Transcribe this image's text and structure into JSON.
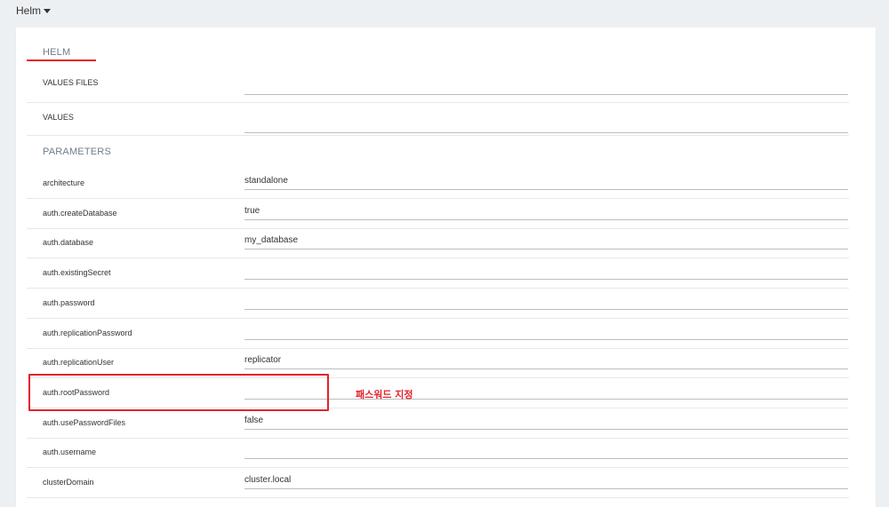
{
  "header": {
    "menu_label": "Helm"
  },
  "helm": {
    "section_title": "HELM",
    "values_files_label": "VALUES FILES",
    "values_files_value": "",
    "values_label": "VALUES",
    "values_value": ""
  },
  "parameters": {
    "section_title": "PARAMETERS",
    "rows": [
      {
        "label": "architecture",
        "value": "standalone"
      },
      {
        "label": "auth.createDatabase",
        "value": "true"
      },
      {
        "label": "auth.database",
        "value": "my_database"
      },
      {
        "label": "auth.existingSecret",
        "value": ""
      },
      {
        "label": "auth.password",
        "value": ""
      },
      {
        "label": "auth.replicationPassword",
        "value": ""
      },
      {
        "label": "auth.replicationUser",
        "value": "replicator"
      },
      {
        "label": "auth.rootPassword",
        "value": ""
      },
      {
        "label": "auth.usePasswordFiles",
        "value": "false"
      },
      {
        "label": "auth.username",
        "value": ""
      },
      {
        "label": "clusterDomain",
        "value": "cluster.local"
      }
    ]
  },
  "annotation": {
    "text": "패스워드 지정",
    "color": "#e3222a"
  },
  "colors": {
    "background": "#edf0f3",
    "panel": "#ffffff",
    "accent_red": "#e3222a",
    "section_title": "#6d7d8c"
  }
}
